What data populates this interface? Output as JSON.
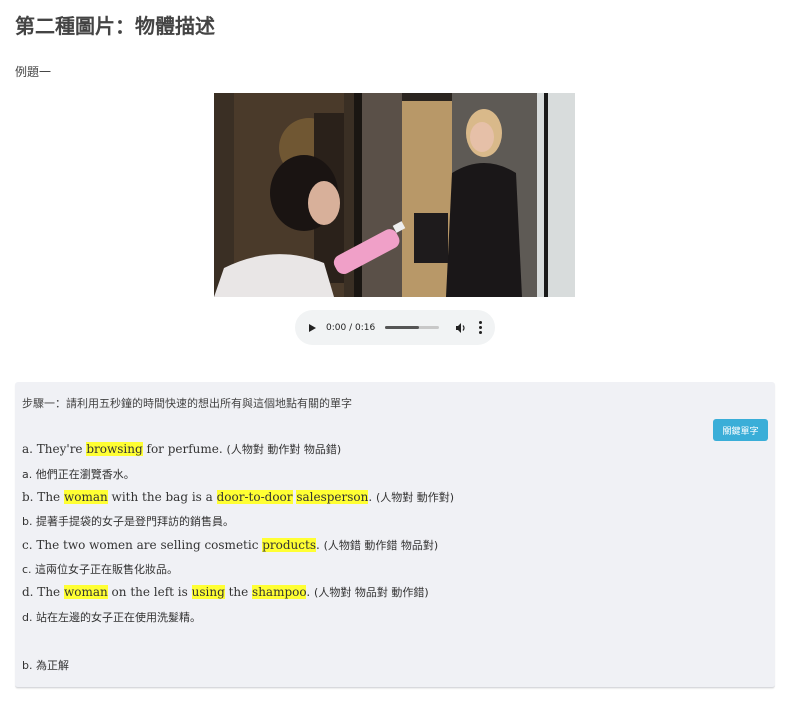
{
  "page": {
    "title": "第二種圖片：物體描述",
    "example_label": "例題一"
  },
  "audio": {
    "time": "0:00 / 0:16",
    "progress": 0.62
  },
  "step": {
    "instruction": "步驟一：請利用五秒鐘的時間快速的想出所有與這個地點有關的單字",
    "keyword_button": "關鍵單字"
  },
  "options": [
    {
      "id": "a",
      "en_parts": [
        {
          "t": "a. They're ",
          "hl": false
        },
        {
          "t": "browsing",
          "hl": true
        },
        {
          "t": " for perfume. ",
          "hl": false
        }
      ],
      "tag": "(人物對 動作對 物品錯)",
      "zh": "a. 他們正在瀏覽香水。"
    },
    {
      "id": "b",
      "en_parts": [
        {
          "t": "b. The ",
          "hl": false
        },
        {
          "t": "woman",
          "hl": true
        },
        {
          "t": " with the bag is a ",
          "hl": false
        },
        {
          "t": "door-to-door",
          "hl": true
        },
        {
          "t": " ",
          "hl": false
        },
        {
          "t": "salesperson",
          "hl": true
        },
        {
          "t": ". ",
          "hl": false
        }
      ],
      "tag": "(人物對 動作對)",
      "zh": "b. 提著手提袋的女子是登門拜訪的銷售員。"
    },
    {
      "id": "c",
      "en_parts": [
        {
          "t": "c. The two women are selling cosmetic ",
          "hl": false
        },
        {
          "t": "products",
          "hl": true
        },
        {
          "t": ". ",
          "hl": false
        }
      ],
      "tag": "(人物錯 動作錯 物品對)",
      "zh": "c. 這兩位女子正在販售化妝品。"
    },
    {
      "id": "d",
      "en_parts": [
        {
          "t": "d. The ",
          "hl": false
        },
        {
          "t": "woman",
          "hl": true
        },
        {
          "t": " on the left is ",
          "hl": false
        },
        {
          "t": "using",
          "hl": true
        },
        {
          "t": " the ",
          "hl": false
        },
        {
          "t": "shampoo",
          "hl": true
        },
        {
          "t": ". ",
          "hl": false
        }
      ],
      "tag": "(人物對 物品對 動作錯)",
      "zh": "d. 站在左邊的女子正在使用洗髮精。"
    }
  ],
  "answer": "b. 為正解",
  "colors": {
    "highlight": "#ffff33",
    "button": "#3aaed8",
    "panel": "#f0f1f5"
  }
}
